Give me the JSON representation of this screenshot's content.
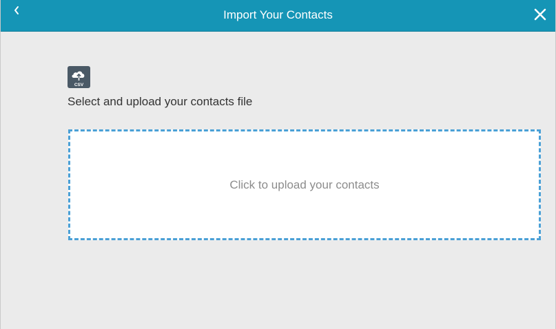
{
  "header": {
    "title": "Import Your Contacts",
    "back_icon": "chevron-left-icon",
    "close_icon": "close-icon",
    "background_color": "#1595b6"
  },
  "main": {
    "file_icon": "csv-upload-icon",
    "file_icon_label": "CSV",
    "instruction": "Select and upload your contacts file",
    "dropzone_text": "Click to upload your contacts",
    "dropzone_border_color": "#4aa0d6"
  }
}
